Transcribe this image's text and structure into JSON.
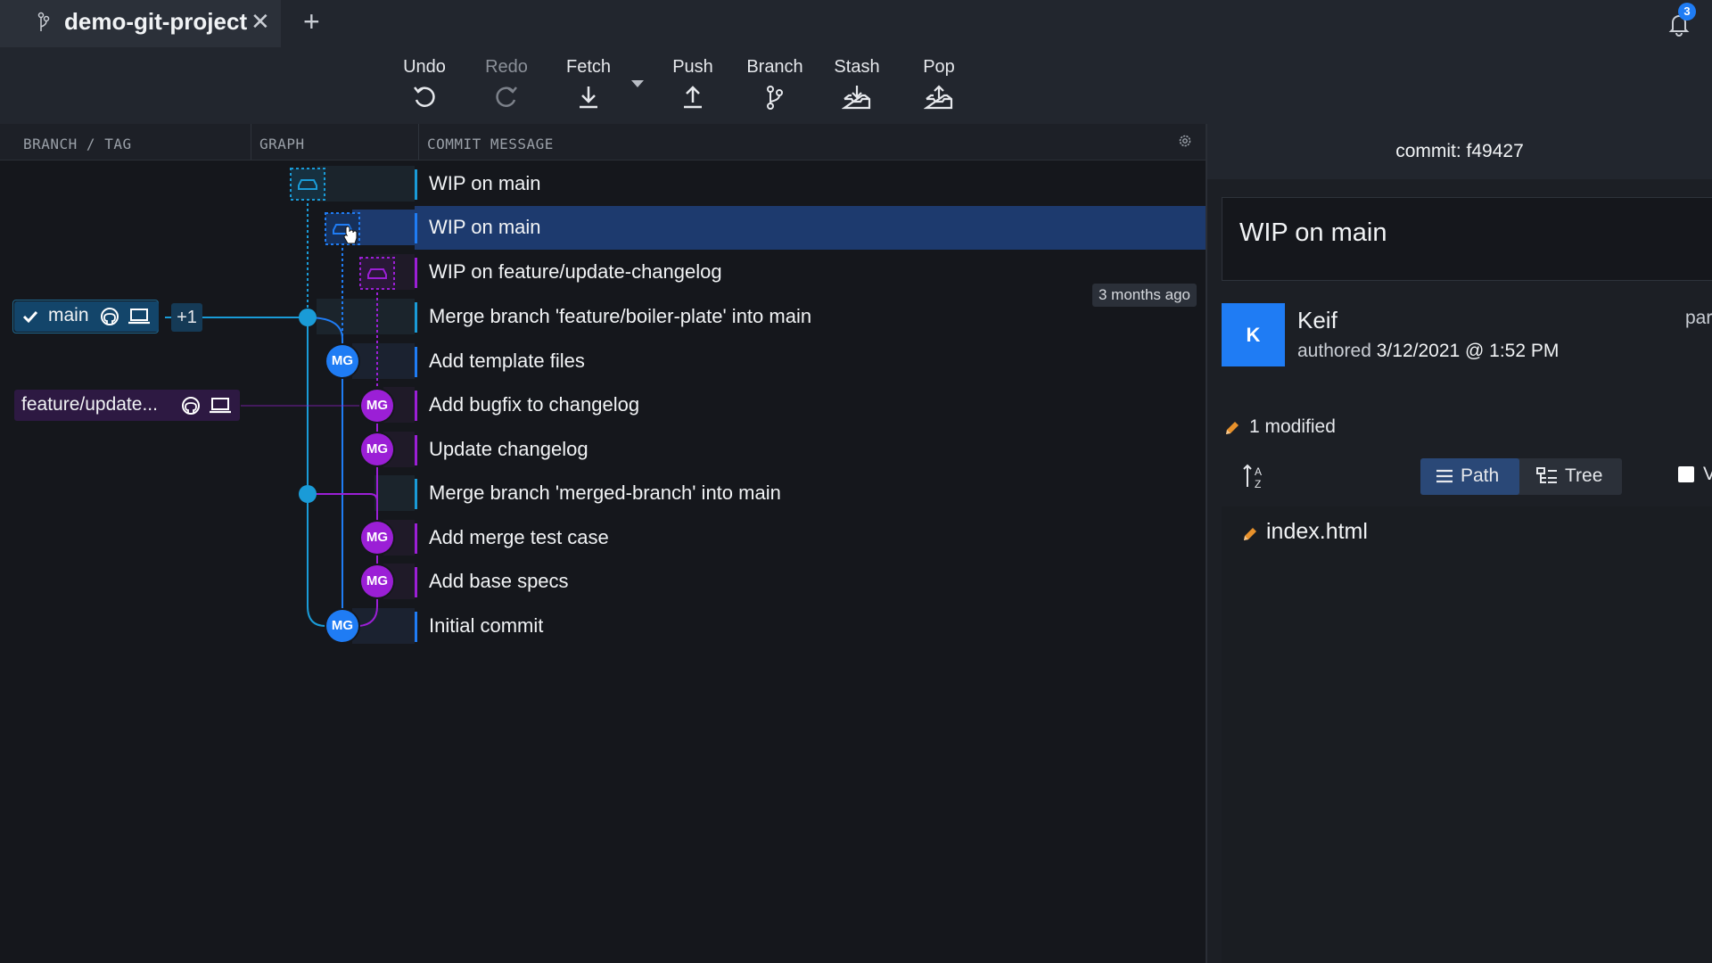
{
  "tabs": [
    {
      "title": "demo-git-project",
      "icon": "git-branch-icon",
      "close": "✕"
    }
  ],
  "new_tab": "+",
  "notifications": {
    "count": "3",
    "icon": "bell-icon"
  },
  "toolbar": {
    "undo": "Undo",
    "redo": "Redo",
    "fetch": "Fetch",
    "push": "Push",
    "branch": "Branch",
    "stash": "Stash",
    "pop": "Pop"
  },
  "columns": {
    "branch_tag": "BRANCH / TAG",
    "graph": "GRAPH",
    "commit_message": "COMMIT MESSAGE"
  },
  "commits": [
    {
      "message": "WIP on main"
    },
    {
      "message": "WIP on main",
      "selected": true
    },
    {
      "message": "WIP on feature/update-changelog"
    },
    {
      "message": "Merge branch 'feature/boiler-plate' into main"
    },
    {
      "message": "Add template files"
    },
    {
      "message": "Add bugfix to changelog"
    },
    {
      "message": "Update changelog"
    },
    {
      "message": "Merge branch 'merged-branch' into main"
    },
    {
      "message": "Add merge test case"
    },
    {
      "message": "Add base specs"
    },
    {
      "message": "Initial commit"
    }
  ],
  "avatar_initials": "MG",
  "branches": {
    "main": {
      "name": "main",
      "extra": "+1",
      "checked": true
    },
    "feature": {
      "name": "feature/update..."
    }
  },
  "time_badge": "3 months ago",
  "details": {
    "commit_label": "commit: f49427",
    "summary": "WIP on main",
    "author_initial": "K",
    "author": "Keif",
    "authored_prefix": "authored",
    "authored_date": "3/12/2021 @ 1:52 PM",
    "parent_label": "par",
    "modified": "1 modified",
    "view_path": "Path",
    "view_tree": "Tree",
    "view_all_label": "V",
    "files": [
      {
        "name": "index.html",
        "status": "modified"
      }
    ]
  },
  "colors": {
    "accent_blue": "#1f7cf4",
    "main_branch": "#1a9bd7",
    "feature_branch": "#9b1fd6",
    "selected_row": "#1d3a6e"
  }
}
